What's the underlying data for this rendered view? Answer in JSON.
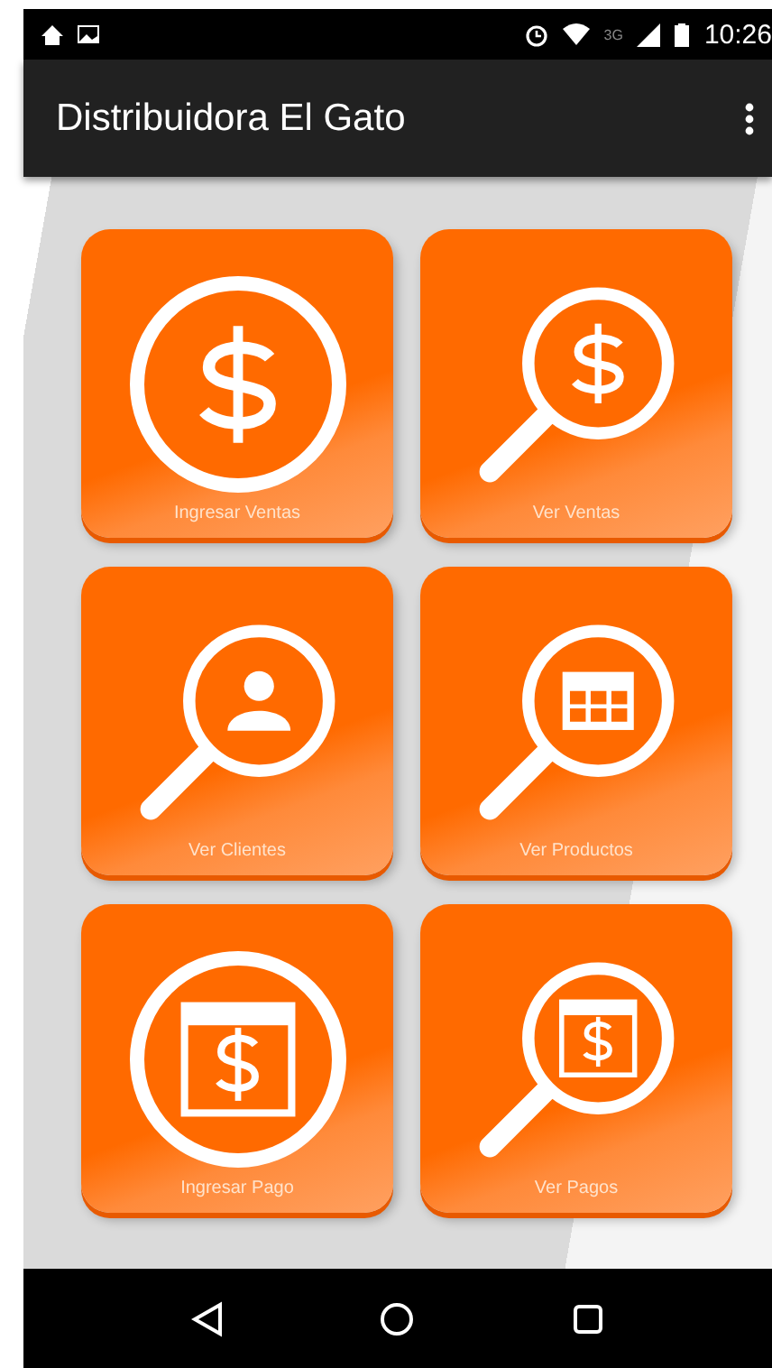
{
  "status_bar": {
    "network": "3G",
    "time": "10:26"
  },
  "app_bar": {
    "title": "Distribuidora El Gato"
  },
  "tiles": [
    {
      "label": "Ingresar Ventas",
      "kind": "circle",
      "symbol": {
        "kind": "dollar"
      }
    },
    {
      "label": "Ver Ventas",
      "kind": "magnifier",
      "symbol": {
        "kind": "dollar"
      }
    },
    {
      "label": "Ver Clientes",
      "kind": "magnifier",
      "symbol": {
        "kind": "person"
      }
    },
    {
      "label": "Ver Productos",
      "kind": "magnifier",
      "symbol": {
        "kind": "grid"
      }
    },
    {
      "label": "Ingresar Pago",
      "kind": "circle",
      "symbol": {
        "kind": "bill"
      }
    },
    {
      "label": "Ver Pagos",
      "kind": "magnifier",
      "symbol": {
        "kind": "bill"
      }
    }
  ]
}
